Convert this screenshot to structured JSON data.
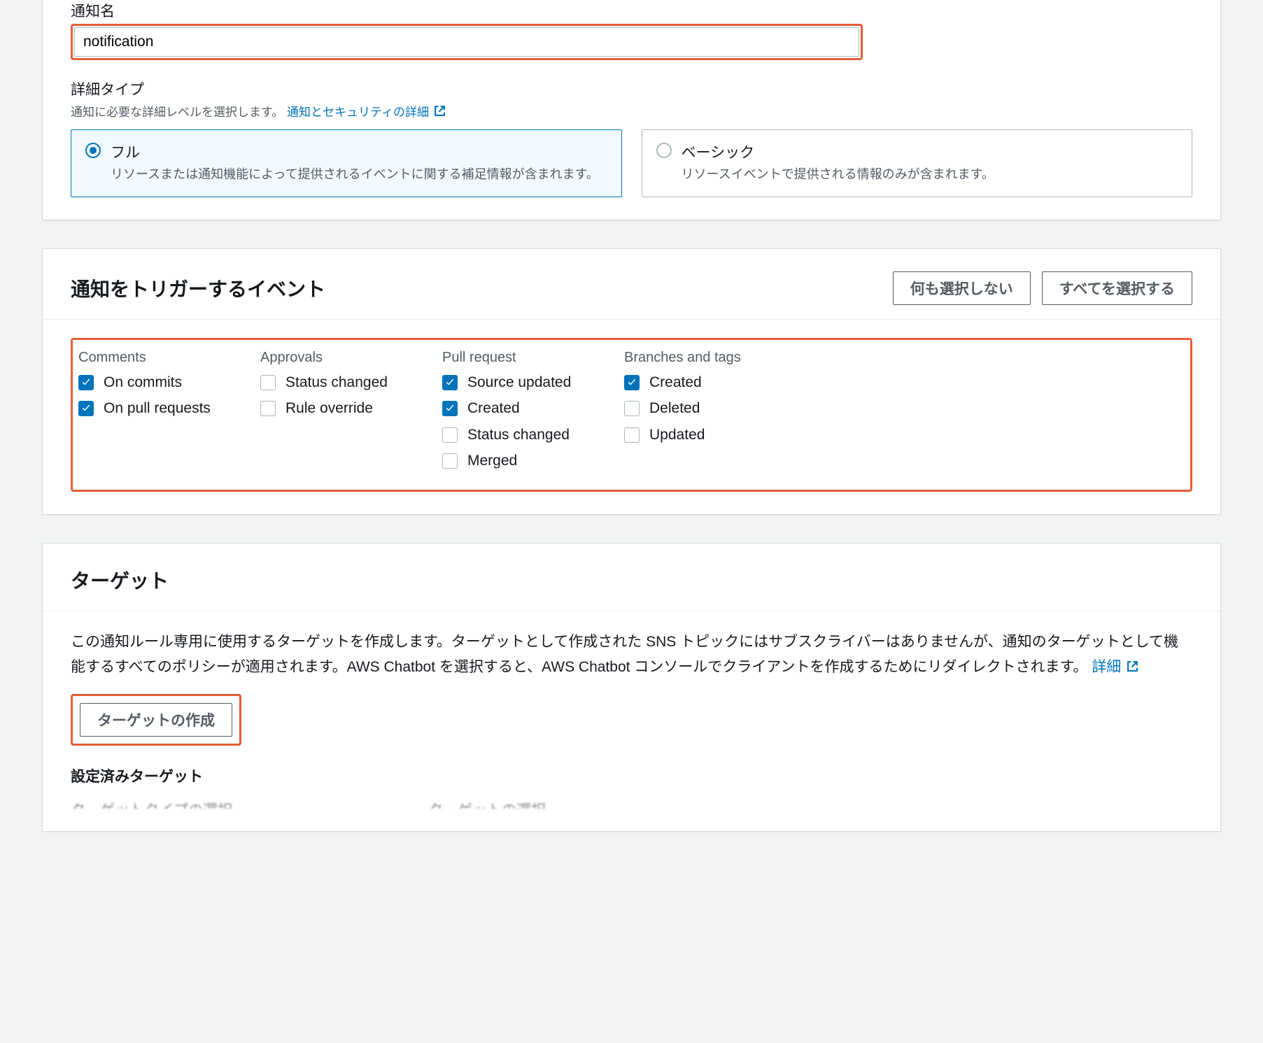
{
  "notificationName": {
    "label": "通知名",
    "value": "notification"
  },
  "detailType": {
    "label": "詳細タイプ",
    "sub": "通知に必要な詳細レベルを選択します。",
    "link": "通知とセキュリティの詳細",
    "options": [
      {
        "title": "フル",
        "desc": "リソースまたは通知機能によって提供されるイベントに関する補足情報が含まれます。",
        "selected": true
      },
      {
        "title": "ベーシック",
        "desc": "リソースイベントで提供される情報のみが含まれます。",
        "selected": false
      }
    ]
  },
  "events": {
    "title": "通知をトリガーするイベント",
    "deselectAll": "何も選択しない",
    "selectAll": "すべてを選択する",
    "columns": [
      {
        "title": "Comments",
        "items": [
          {
            "label": "On commits",
            "checked": true
          },
          {
            "label": "On pull requests",
            "checked": true
          }
        ]
      },
      {
        "title": "Approvals",
        "items": [
          {
            "label": "Status changed",
            "checked": false
          },
          {
            "label": "Rule override",
            "checked": false
          }
        ]
      },
      {
        "title": "Pull request",
        "items": [
          {
            "label": "Source updated",
            "checked": true
          },
          {
            "label": "Created",
            "checked": true
          },
          {
            "label": "Status changed",
            "checked": false
          },
          {
            "label": "Merged",
            "checked": false
          }
        ]
      },
      {
        "title": "Branches and tags",
        "items": [
          {
            "label": "Created",
            "checked": true
          },
          {
            "label": "Deleted",
            "checked": false
          },
          {
            "label": "Updated",
            "checked": false
          }
        ]
      }
    ]
  },
  "targets": {
    "title": "ターゲット",
    "desc": "この通知ルール専用に使用するターゲットを作成します。ターゲットとして作成された SNS トピックにはサブスクライバーはありませんが、通知のターゲットとして機能するすべてのポリシーが適用されます。AWS Chatbot を選択すると、AWS Chatbot コンソールでクライアントを作成するためにリダイレクトされます。",
    "detailsLink": "詳細",
    "createButton": "ターゲットの作成",
    "configuredTitle": "設定済みターゲット",
    "cutoff1": "ターゲットタイプの選択",
    "cutoff2": "ターゲットの選択"
  }
}
